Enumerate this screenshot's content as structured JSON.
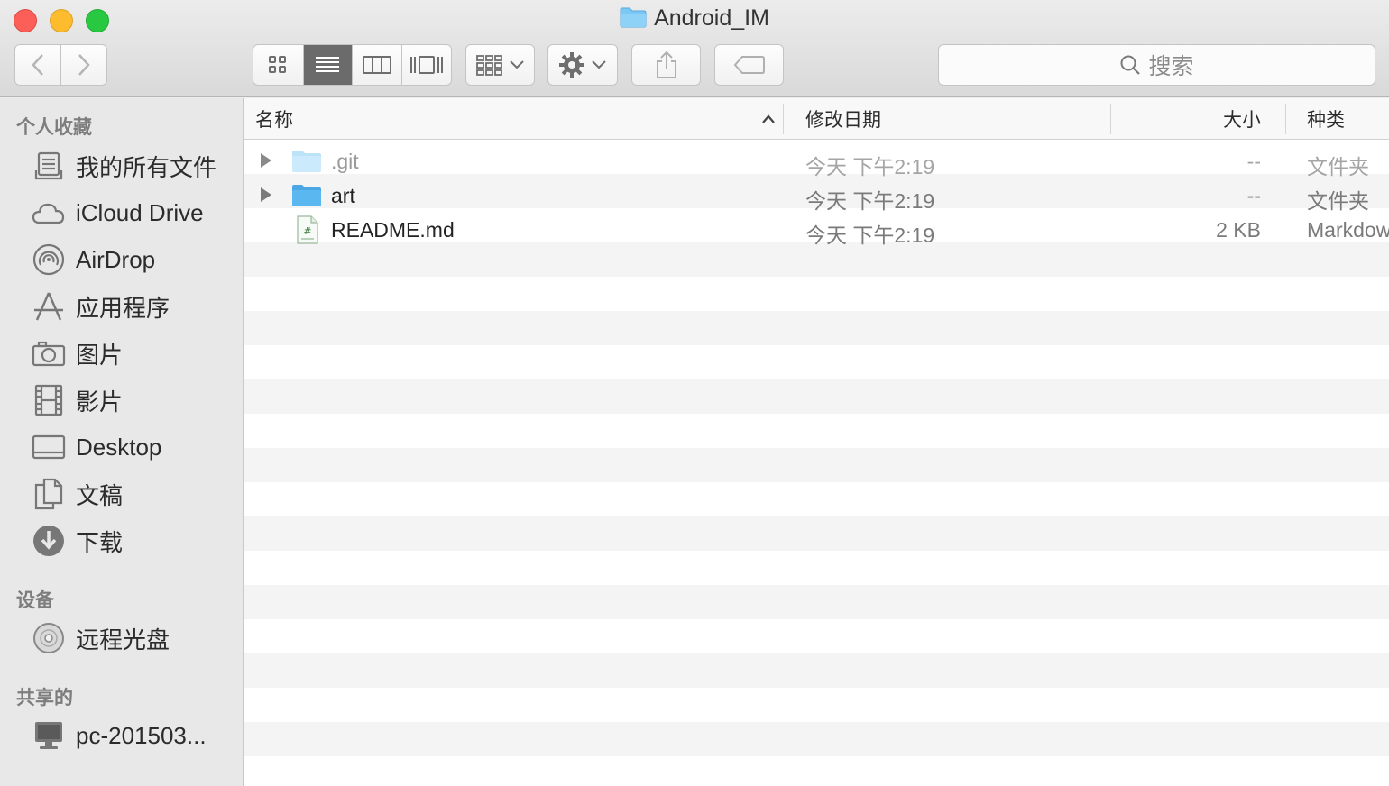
{
  "window": {
    "title": "Android_IM"
  },
  "toolbar": {
    "back_icon": "chevron-left-icon",
    "forward_icon": "chevron-right-icon",
    "view_modes": [
      "icon-view",
      "list-view",
      "column-view",
      "cover-flow-view"
    ],
    "active_view": "list-view",
    "search_placeholder": "搜索"
  },
  "sidebar": {
    "favorites_header": "个人收藏",
    "favorites": [
      {
        "label": "我的所有文件",
        "icon": "all-files-icon"
      },
      {
        "label": "iCloud Drive",
        "icon": "cloud-icon"
      },
      {
        "label": "AirDrop",
        "icon": "airdrop-icon"
      },
      {
        "label": "应用程序",
        "icon": "applications-icon"
      },
      {
        "label": "图片",
        "icon": "camera-icon"
      },
      {
        "label": "影片",
        "icon": "film-icon"
      },
      {
        "label": "Desktop",
        "icon": "desktop-icon"
      },
      {
        "label": "文稿",
        "icon": "documents-icon"
      },
      {
        "label": "下载",
        "icon": "download-icon"
      }
    ],
    "devices_header": "设备",
    "devices": [
      {
        "label": "远程光盘",
        "icon": "disc-icon"
      }
    ],
    "shared_header": "共享的",
    "shared": [
      {
        "label": "pc-201503...",
        "icon": "computer-icon"
      }
    ]
  },
  "list": {
    "columns": {
      "name": "名称",
      "date": "修改日期",
      "size": "大小",
      "kind": "种类"
    },
    "sort_indicator": "chevron-up-icon",
    "rows": [
      {
        "name": ".git",
        "date": "今天 下午2:19",
        "size": "--",
        "kind": "文件夹",
        "type": "folder",
        "hidden": true
      },
      {
        "name": "art",
        "date": "今天 下午2:19",
        "size": "--",
        "kind": "文件夹",
        "type": "folder",
        "hidden": false
      },
      {
        "name": "README.md",
        "date": "今天 下午2:19",
        "size": "2 KB",
        "kind": "Markdown",
        "type": "markdown",
        "hidden": false
      }
    ]
  },
  "colors": {
    "folder_blue": "#5bb7f0",
    "close": "#fc5f57",
    "minimize": "#fdbc2e",
    "maximize": "#28c840"
  }
}
